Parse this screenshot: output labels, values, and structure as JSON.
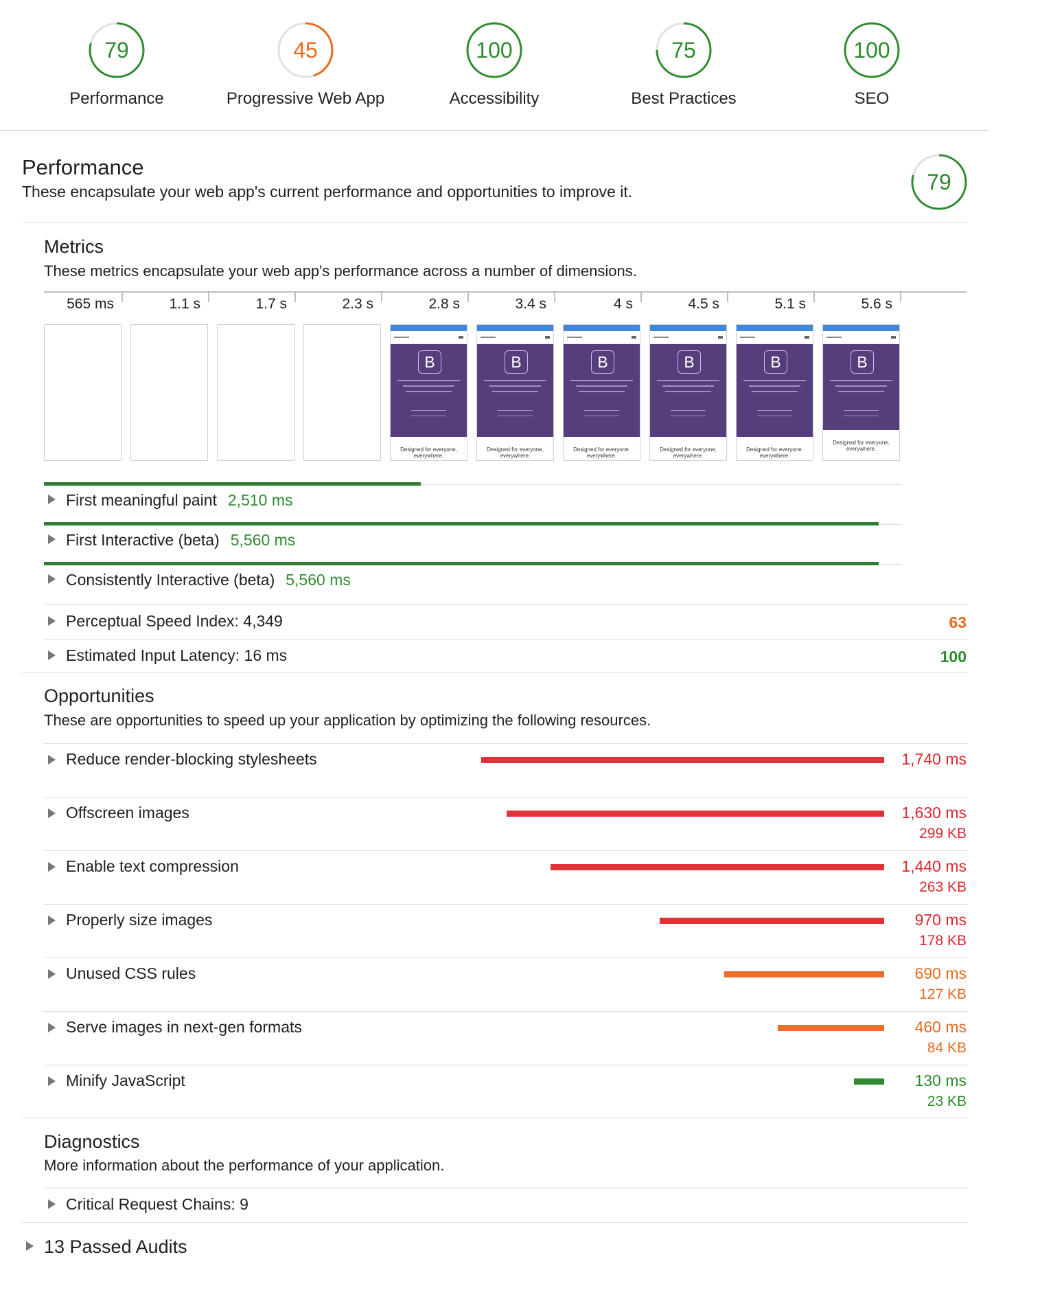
{
  "header": {
    "gauges": [
      {
        "value": "79",
        "label": "Performance",
        "score": 0.79,
        "color": "#2e8b2e"
      },
      {
        "value": "45",
        "label": "Progressive Web App",
        "score": 0.45,
        "color": "#e86a1f"
      },
      {
        "value": "100",
        "label": "Accessibility",
        "score": 1.0,
        "color": "#2e8b2e"
      },
      {
        "value": "75",
        "label": "Best Practices",
        "score": 0.75,
        "color": "#2e8b2e"
      },
      {
        "value": "100",
        "label": "SEO",
        "score": 1.0,
        "color": "#2e8b2e"
      }
    ]
  },
  "performance": {
    "title": "Performance",
    "description": "These encapsulate your web app's current performance and opportunities to improve it.",
    "score": "79",
    "metrics": {
      "title": "Metrics",
      "description": "These metrics encapsulate your web app's performance across a number of dimensions.",
      "filmstrip": {
        "times": [
          "565 ms",
          "1.1 s",
          "1.7 s",
          "2.3 s",
          "2.8 s",
          "3.4 s",
          "4 s",
          "4.5 s",
          "5.1 s",
          "5.6 s"
        ],
        "frame_logo": "B",
        "frame_footer": "Designed for everyone, everywhere."
      },
      "items": [
        {
          "label": "First meaningful paint",
          "value": "2,510 ms",
          "fraction": 0.4464
        },
        {
          "label": "First Interactive (beta)",
          "value": "5,560 ms",
          "fraction": 0.9888
        },
        {
          "label": "Consistently Interactive (beta)",
          "value": "5,560 ms",
          "fraction": 0.9888
        }
      ],
      "scored": [
        {
          "label": "Perceptual Speed Index: 4,349",
          "score": "63",
          "color": "#e86a1f"
        },
        {
          "label": "Estimated Input Latency: 16 ms",
          "score": "100",
          "color": "#2e8b2e"
        }
      ]
    },
    "opportunities": {
      "title": "Opportunities",
      "description": "These are opportunities to speed up your application by optimizing the following resources.",
      "items": [
        {
          "label": "Reduce render-blocking stylesheets",
          "ms": "1,740 ms",
          "kb": "",
          "level": "red",
          "fraction": 1.0
        },
        {
          "label": "Offscreen images",
          "ms": "1,630 ms",
          "kb": "299 KB",
          "level": "red",
          "fraction": 0.9368
        },
        {
          "label": "Enable text compression",
          "ms": "1,440 ms",
          "kb": "263 KB",
          "level": "red",
          "fraction": 0.8276
        },
        {
          "label": "Properly size images",
          "ms": "970 ms",
          "kb": "178 KB",
          "level": "red",
          "fraction": 0.5575
        },
        {
          "label": "Unused CSS rules",
          "ms": "690 ms",
          "kb": "127 KB",
          "level": "orange",
          "fraction": 0.3966
        },
        {
          "label": "Serve images in next-gen formats",
          "ms": "460 ms",
          "kb": "84 KB",
          "level": "orange",
          "fraction": 0.2644
        },
        {
          "label": "Minify JavaScript",
          "ms": "130 ms",
          "kb": "23 KB",
          "level": "green",
          "fraction": 0.0747
        }
      ]
    },
    "diagnostics": {
      "title": "Diagnostics",
      "description": "More information about the performance of your application.",
      "items": [
        {
          "label": "Critical Request Chains: 9"
        }
      ]
    },
    "passed": "13 Passed Audits"
  }
}
